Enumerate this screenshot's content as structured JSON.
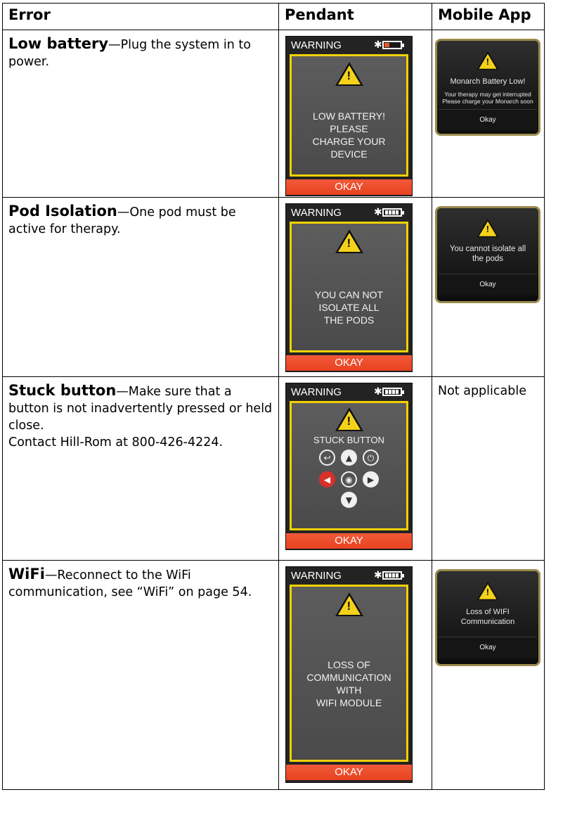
{
  "headers": [
    "Error",
    "Pendant",
    "Mobile App"
  ],
  "rows": [
    {
      "title": "Low battery",
      "desc": "—Plug the system in to power.",
      "pendant": {
        "warning": "WARNING",
        "bluetooth": "✱",
        "battery": "low",
        "message": [
          "LOW BATTERY!",
          "PLEASE",
          "CHARGE YOUR",
          "DEVICE"
        ],
        "okay": "OKAY"
      },
      "mobile": {
        "title": "Monarch Battery Low!",
        "sub": [
          "Your therapy may get interrupted",
          "Please charge  your Monarch soon"
        ],
        "okay": "Okay"
      }
    },
    {
      "title": "Pod Isolation",
      "desc": "—One pod must be active for therapy.",
      "pendant": {
        "warning": "WARNING",
        "bluetooth": "✱",
        "battery": "full",
        "message": [
          "YOU CAN NOT",
          "ISOLATE ALL",
          "THE PODS"
        ],
        "okay": "OKAY"
      },
      "mobile": {
        "title": "You cannot isolate all the pods",
        "okay": "Okay"
      }
    },
    {
      "title": "Stuck button",
      "desc": "—Make sure that a button is not inadvertently pressed or held close.",
      "desc2": "Contact Hill-Rom at 800-426-4224.",
      "pendant": {
        "warning": "WARNING",
        "bluetooth": "✱",
        "battery": "full",
        "message": [
          "STUCK BUTTON"
        ],
        "okay": "OKAY",
        "icons": [
          "back-icon",
          "up-arrow-icon",
          "power-icon",
          "left-arrow-icon",
          "center-button-icon",
          "right-arrow-icon",
          "down-arrow-icon"
        ]
      },
      "mobile_na": "Not applicable"
    },
    {
      "title": "WiFi",
      "desc": "—Reconnect to the WiFi communication, see “WiFi” on page 54.",
      "pendant": {
        "warning": "WARNING",
        "bluetooth": "✱",
        "battery": "full",
        "message": [
          "LOSS OF",
          "COMMUNICATION",
          "WITH",
          "WIFI MODULE"
        ],
        "okay": "OKAY"
      },
      "mobile": {
        "title": "Loss of WIFI Communication",
        "okay": "Okay"
      }
    }
  ],
  "colors": {
    "screen_border": "#f2d100",
    "okay_bar": "#e8421f",
    "mobile_border": "#9c8a4d",
    "stuck_button_highlight": "#d9302a"
  }
}
